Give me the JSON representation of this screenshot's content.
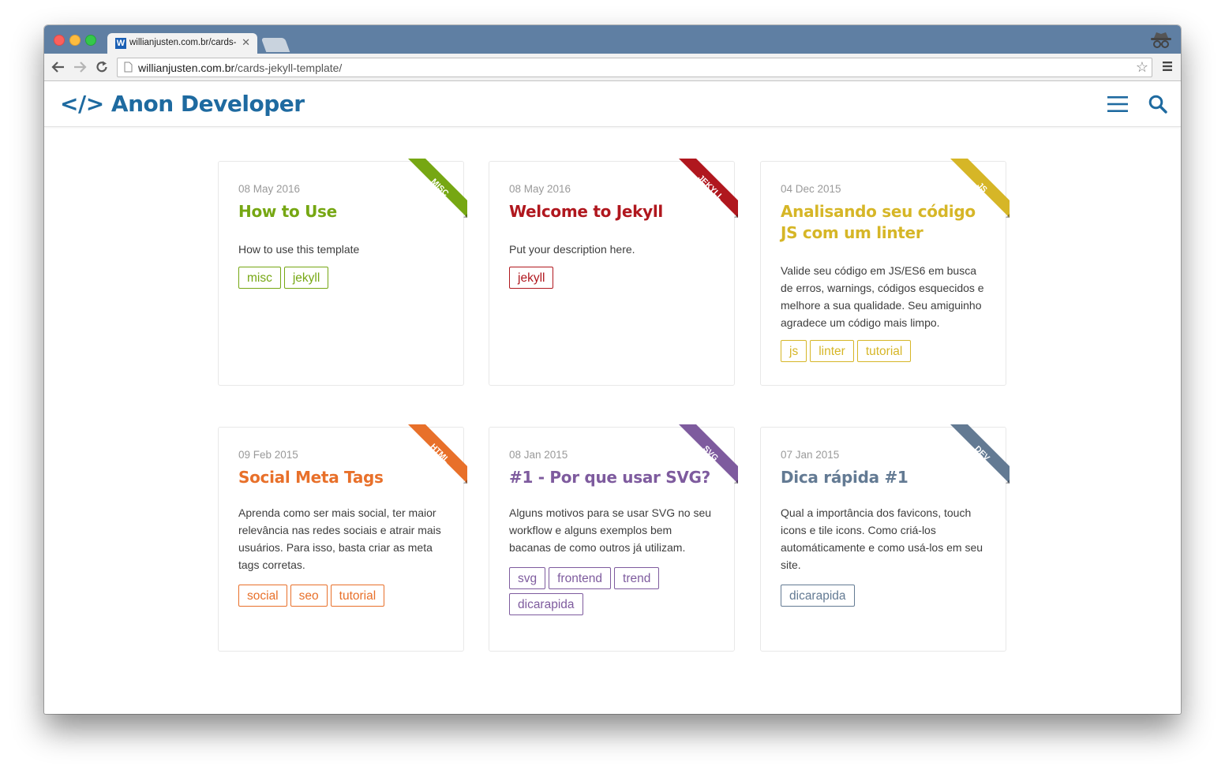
{
  "browser": {
    "tab_title": "willianjusten.com.br/cards-",
    "tab_favicon_letter": "W",
    "url_domain": "willianjusten.com.br",
    "url_path": "/cards-jekyll-template/"
  },
  "site": {
    "logo_code": "</>",
    "logo_text": "Anon Developer",
    "brand_color": "#1e6aa0"
  },
  "cards": [
    {
      "ribbon": "MISC",
      "color": "#76a713",
      "date": "08 May 2016",
      "title": "How to Use",
      "description": "How to use this template",
      "tags": [
        "misc",
        "jekyll"
      ]
    },
    {
      "ribbon": "JEKYLL",
      "color": "#b0171e",
      "date": "08 May 2016",
      "title": "Welcome to Jekyll",
      "description": "Put your description here.",
      "tags": [
        "jekyll"
      ]
    },
    {
      "ribbon": "JS",
      "color": "#d6b627",
      "date": "04 Dec 2015",
      "title": "Analisando seu código JS com um linter",
      "description": "Valide seu código em JS/ES6 em busca de erros, warnings, códigos esquecidos e melhore a sua qualidade. Seu amiguinho agradece um código mais limpo.",
      "tags": [
        "js",
        "linter",
        "tutorial"
      ]
    },
    {
      "ribbon": "HTML",
      "color": "#e8702a",
      "date": "09 Feb 2015",
      "title": "Social Meta Tags",
      "description": "Aprenda como ser mais social, ter maior relevância nas redes sociais e atrair mais usuários. Para isso, basta criar as meta tags corretas.",
      "tags": [
        "social",
        "seo",
        "tutorial"
      ]
    },
    {
      "ribbon": "SVG",
      "color": "#7e5b9e",
      "date": "08 Jan 2015",
      "title": "#1 - Por que usar SVG?",
      "description": "Alguns motivos para se usar SVG no seu workflow e alguns exemplos bem bacanas de como outros já utilizam.",
      "tags": [
        "svg",
        "frontend",
        "trend",
        "dicarapida"
      ]
    },
    {
      "ribbon": "DEV",
      "color": "#637a93",
      "date": "07 Jan 2015",
      "title": "Dica rápida #1",
      "description": "Qual a importância dos favicons, touch icons e tile icons. Como criá-los automáticamente e como usá-los em seu site.",
      "tags": [
        "dicarapida"
      ]
    }
  ]
}
